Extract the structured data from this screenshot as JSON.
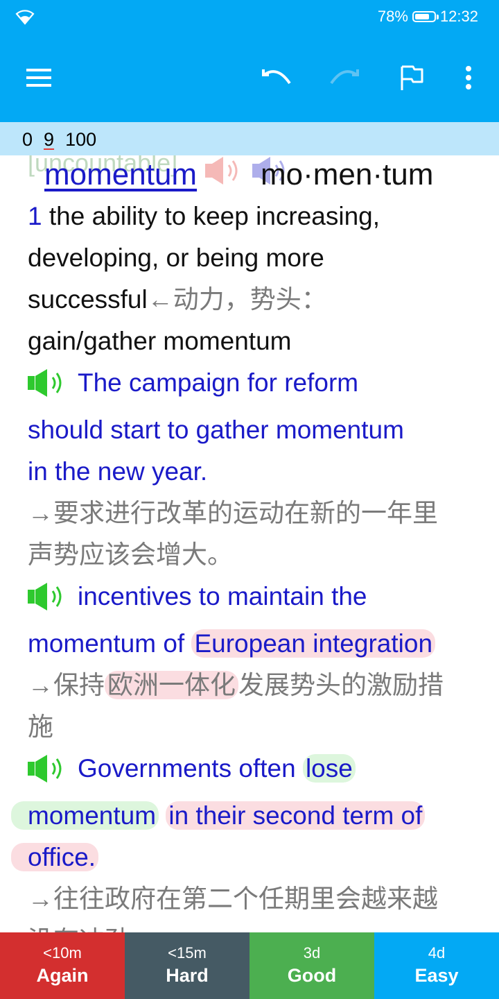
{
  "status_bar": {
    "battery_percent": "78%",
    "battery_level": 0.78,
    "time": "12:32"
  },
  "app_bar": {
    "icons": [
      "menu-icon",
      "undo-icon",
      "redo-icon",
      "flag-icon",
      "more-vert-icon"
    ]
  },
  "counts": {
    "new": "0",
    "learn": "9",
    "review": "100"
  },
  "card": {
    "tag": "[uncountable]",
    "headword": "momentum",
    "pronunciation": "mo·men·tum",
    "sense_number": "1",
    "definition_lines": [
      " the ability to keep increasing,",
      "developing, or being more",
      "successful"
    ],
    "definition_cn": "←动力，势头：",
    "collocation": "gain/gather momentum",
    "example1": {
      "lines": [
        "The campaign for reform",
        "should start to gather momentum",
        "in the new year."
      ],
      "cn_lines": [
        "→要求进行改革的运动在新的一年里",
        "声势应该会增大。"
      ]
    },
    "example2": {
      "line1": "incentives to maintain the",
      "line2_a": "momentum of",
      "line2_hl": "European integration",
      "cn_a": "→保持",
      "cn_hl": "欧洲一体化",
      "cn_b": "发展势头的激励措",
      "cn_c": "施"
    },
    "example3": {
      "line1_a": "Governments often",
      "line1_hl": "lose",
      "line2_hl_green": "momentum",
      "line2_hl_red": "in their second term of",
      "line3_hl": "office.",
      "cn_lines": [
        "→往往政府在第二个任期里会越来越",
        "没有冲劲。"
      ]
    }
  },
  "answers": [
    {
      "interval": "<10m",
      "label": "Again",
      "color": "#d32f2f"
    },
    {
      "interval": "<15m",
      "label": "Hard",
      "color": "#455a64"
    },
    {
      "interval": "3d",
      "label": "Good",
      "color": "#4caf50"
    },
    {
      "interval": "4d",
      "label": "Easy",
      "color": "#03a9f4"
    }
  ]
}
